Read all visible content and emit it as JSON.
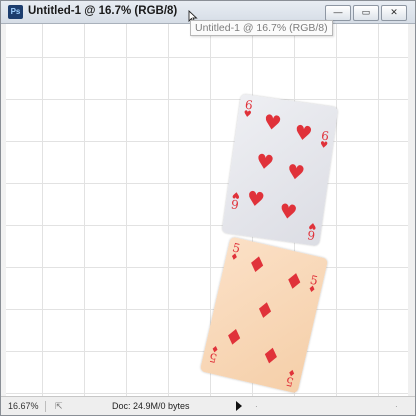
{
  "window": {
    "title": "Untitled-1 @ 16.7% (RGB/8)",
    "tooltip": "Untitled-1 @ 16.7% (RGB/8)",
    "app_icon_label": "Ps",
    "controls": {
      "minimize": "—",
      "maximize": "▭",
      "close": "✕"
    }
  },
  "cards": [
    {
      "rank": "6",
      "suit": "♥",
      "suit_name": "hearts",
      "color": "#e0323a",
      "background": "#e6e7ec"
    },
    {
      "rank": "5",
      "suit": "♦",
      "suit_name": "diamonds",
      "color": "#e0323a",
      "background": "#f8d8b8"
    }
  ],
  "status_bar": {
    "zoom": "16.67%",
    "doc_info": "Doc: 24.9M/0 bytes",
    "share_icon": "share-icon"
  },
  "colors": {
    "titlebar": "#dde3ea",
    "canvas": "#ffffff",
    "grid": "#e2e2e2",
    "card_red": "#e0323a"
  }
}
